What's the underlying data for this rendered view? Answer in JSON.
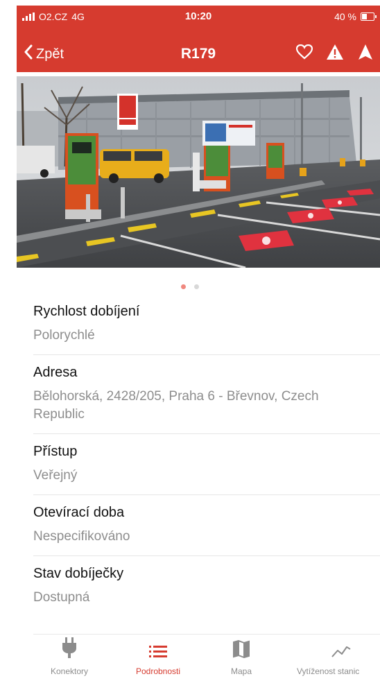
{
  "status_bar": {
    "carrier": "O2.CZ",
    "network": "4G",
    "time": "10:20",
    "battery": "40 %"
  },
  "nav": {
    "back_label": "Zpět",
    "title": "R179",
    "icons": [
      "heart-icon",
      "warning-icon",
      "navigate-arrow-icon"
    ]
  },
  "gallery": {
    "page_count": 2,
    "active_page": 1
  },
  "details": {
    "charging_speed": {
      "label": "Rychlost dobíjení",
      "value": "Polorychlé"
    },
    "address": {
      "label": "Adresa",
      "value": "Bělohorská, 2428/205, Praha 6 - Břevnov, Czech Republic"
    },
    "access": {
      "label": "Přístup",
      "value": "Veřejný"
    },
    "opening_hours": {
      "label": "Otevírací doba",
      "value": "Nespecifikováno"
    },
    "charger_status": {
      "label": "Stav dobíječky",
      "value": "Dostupná"
    }
  },
  "tabs": [
    {
      "label": "Konektory",
      "icon": "plug-icon",
      "active": false
    },
    {
      "label": "Podrobnosti",
      "icon": "list-icon",
      "active": true
    },
    {
      "label": "Mapa",
      "icon": "map-icon",
      "active": false
    },
    {
      "label": "Vytíženost stanic",
      "icon": "chart-line-icon",
      "active": false
    }
  ],
  "colors": {
    "accent": "#d63b2f",
    "inactive_tab": "#8c8c8c",
    "secondary_text": "#8d8d8d"
  }
}
